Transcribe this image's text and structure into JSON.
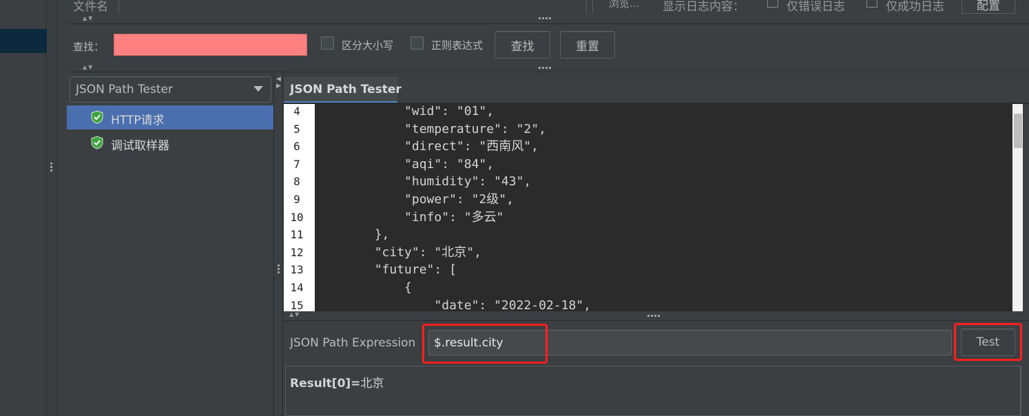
{
  "top": {
    "file_label": "文件名",
    "browse_label": "浏览...",
    "log_label": "显示日志内容：",
    "errors_only_label": "仅错误日志",
    "success_only_label": "仅成功日志",
    "config_label": "配置"
  },
  "search": {
    "label": "查找：",
    "value": "",
    "case_label": "区分大小写",
    "regex_label": "正则表达式",
    "find_label": "查找",
    "reset_label": "重置",
    "input_color": "#ff8080"
  },
  "tree": {
    "selector_value": "JSON Path Tester",
    "items": [
      {
        "label": "HTTP请求",
        "selected": true
      },
      {
        "label": "调试取样器",
        "selected": false
      }
    ]
  },
  "tab": {
    "label": "JSON Path Tester"
  },
  "editor": {
    "lines": [
      {
        "no": "4",
        "text": "            \"wid\": \"01\","
      },
      {
        "no": "5",
        "text": "            \"temperature\": \"2\","
      },
      {
        "no": "6",
        "text": "            \"direct\": \"西南风\","
      },
      {
        "no": "7",
        "text": "            \"aqi\": \"84\","
      },
      {
        "no": "8",
        "text": "            \"humidity\": \"43\","
      },
      {
        "no": "9",
        "text": "            \"power\": \"2级\","
      },
      {
        "no": "10",
        "text": "            \"info\": \"多云\""
      },
      {
        "no": "11",
        "text": "        },"
      },
      {
        "no": "12",
        "text": "        \"city\": \"北京\","
      },
      {
        "no": "13",
        "text": "        \"future\": ["
      },
      {
        "no": "14",
        "text": "            {"
      },
      {
        "no": "15",
        "text": "                \"date\": \"2022-02-18\","
      }
    ]
  },
  "expression": {
    "label": "JSON Path Expression",
    "value": "$.result.city",
    "test_label": "Test"
  },
  "result": {
    "prefix": "Result[0]=",
    "value": "北京"
  },
  "colors": {
    "highlight": "#ff1d1d",
    "selection": "#4b6eaf",
    "tab_underline": "#4a88c7"
  }
}
